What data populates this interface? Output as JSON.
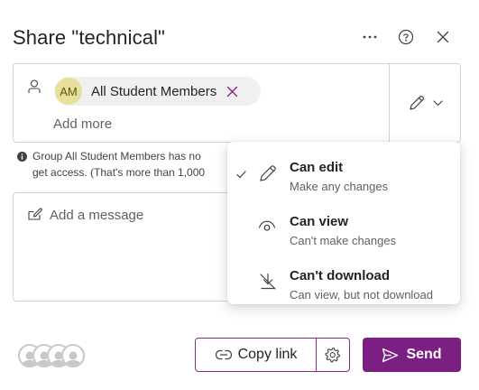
{
  "dialog": {
    "title": "Share \"technical\"",
    "header_actions": [
      {
        "name": "more-options",
        "icon": "more-horizontal-icon"
      },
      {
        "name": "help",
        "icon": "question-circle-icon"
      },
      {
        "name": "close",
        "icon": "close-icon"
      }
    ]
  },
  "recipients": {
    "chips": [
      {
        "initials": "AM",
        "name": "All Student Members",
        "avatar_color": "#e7e09a"
      }
    ],
    "add_placeholder": "Add more",
    "permission_icon": "pencil-icon"
  },
  "info": {
    "icon": "info-icon",
    "lines": [
      "Group All Student Members has no",
      "get access. (That's more than 1,000"
    ]
  },
  "message": {
    "placeholder": "Add a message",
    "icon": "edit-message-icon"
  },
  "permission_menu": {
    "selected": "Can edit",
    "options": [
      {
        "title": "Can edit",
        "description": "Make any changes",
        "icon": "pencil-icon",
        "checked": true
      },
      {
        "title": "Can view",
        "description": "Can't make changes",
        "icon": "eye-icon",
        "checked": false
      },
      {
        "title": "Can't download",
        "description": "Can view, but not download",
        "icon": "no-download-icon",
        "checked": false
      }
    ]
  },
  "footer": {
    "copy_link_label": "Copy link",
    "send_label": "Send",
    "accent_color": "#7b1f82"
  }
}
